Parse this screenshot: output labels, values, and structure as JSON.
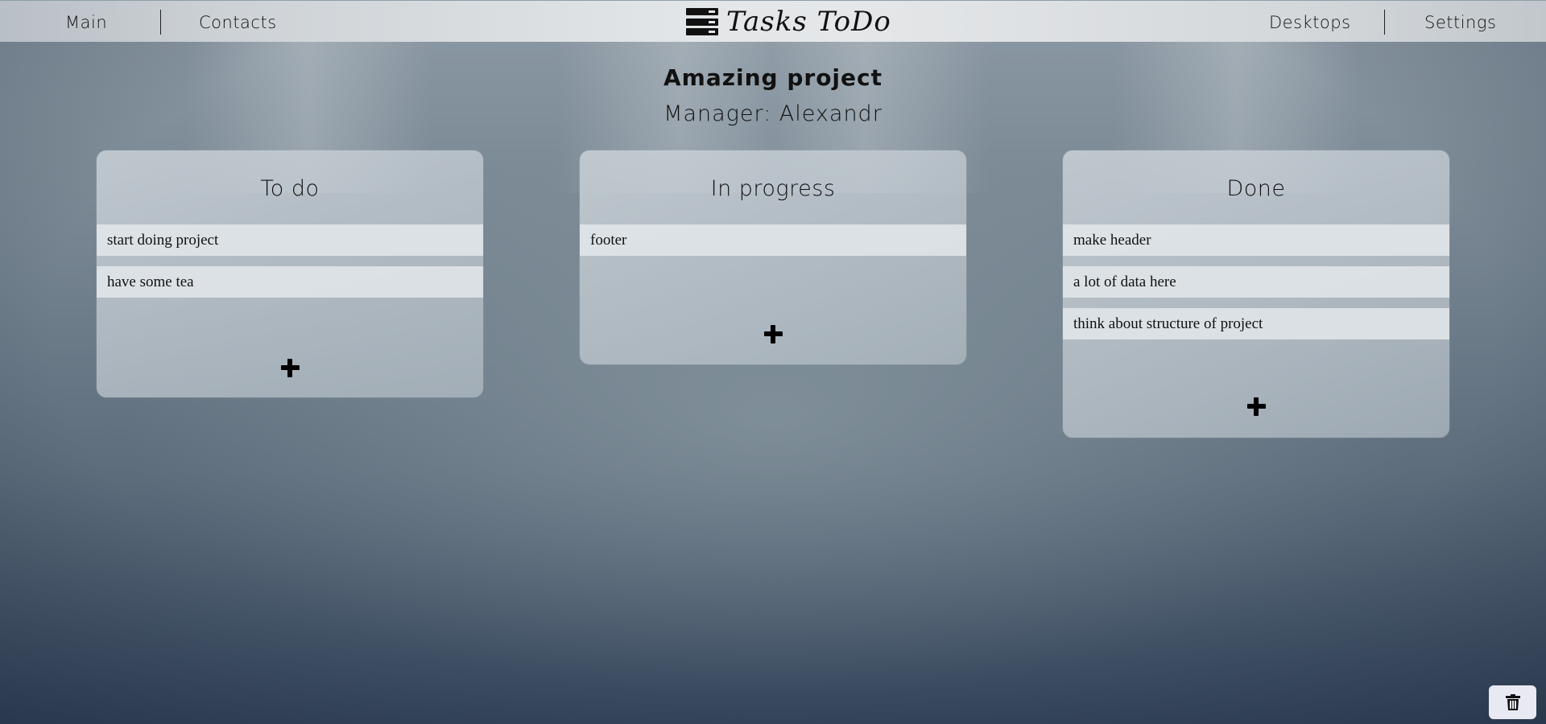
{
  "nav": {
    "left": [
      {
        "label": "Main"
      },
      {
        "label": "Contacts"
      }
    ],
    "right": [
      {
        "label": "Desktops"
      },
      {
        "label": "Settings"
      }
    ],
    "logo_text": "Tasks ToDo",
    "logo_icon": "stacked-list-icon"
  },
  "project": {
    "title": "Amazing project",
    "manager": "Manager: Alexandr"
  },
  "columns": [
    {
      "title": "To do",
      "tasks": [
        "start doing project",
        "have some tea"
      ],
      "add_icon": "plus-icon"
    },
    {
      "title": "In progress",
      "tasks": [
        "footer"
      ],
      "add_icon": "plus-icon"
    },
    {
      "title": "Done",
      "tasks": [
        "make header",
        "a lot of data here",
        "think about structure of project"
      ],
      "add_icon": "plus-icon"
    }
  ],
  "trash": {
    "icon": "trash-icon"
  },
  "colors": {
    "header_bg": "#e3e6e8",
    "card_bg": "#c8cfd5",
    "task_bg": "#e1e6e9",
    "trash_bg": "#e9e9f4"
  }
}
